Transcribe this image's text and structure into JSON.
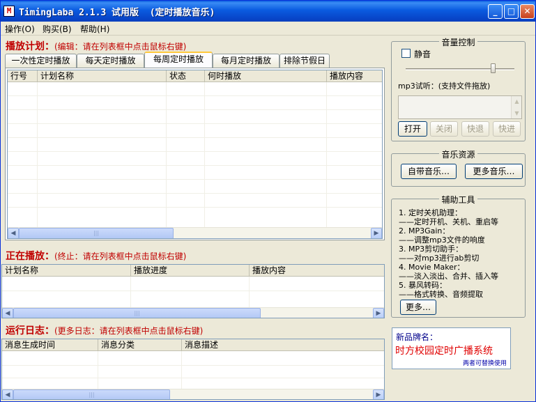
{
  "window": {
    "title": "TimingLaba 2.1.3 试用版  (定时播放音乐)",
    "icon_text": "M",
    "controls": {
      "minimize": "_",
      "maximize": "□",
      "close": "✕"
    }
  },
  "menu": [
    "操作(O)",
    "购买(B)",
    "帮助(H)"
  ],
  "schedule": {
    "title": "播放计划：",
    "hint": "(编辑：请在列表框中点击鼠标右键)",
    "tabs": [
      "一次性定时播放",
      "每天定时播放",
      "每周定时播放",
      "每月定时播放",
      "排除节假日"
    ],
    "active_tab": 2,
    "columns": [
      "行号",
      "计划名称",
      "状态",
      "何时播放",
      "播放内容"
    ]
  },
  "now_playing": {
    "title": "正在播放：",
    "hint": "(终止：请在列表框中点击鼠标右键)",
    "columns": [
      "计划名称",
      "播放进度",
      "播放内容"
    ]
  },
  "log": {
    "title": "运行日志：",
    "hint": "(更多日志：请在列表框中点击鼠标右键)",
    "columns": [
      "消息生成时间",
      "消息分类",
      "消息描述"
    ]
  },
  "volume": {
    "title": "音量控制",
    "mute_label": "静音",
    "mute_checked": false,
    "slider_level": 0.8,
    "mp3_label": "mp3试听：(支持文件拖放)",
    "buttons": [
      "打开",
      "关闭",
      "快退",
      "快进"
    ]
  },
  "music": {
    "title": "音乐资源",
    "builtin_button": "自带音乐…",
    "more_button": "更多音乐…"
  },
  "tools": {
    "title": "辅助工具",
    "lines": [
      "1. 定时关机助理：",
      "——定时开机、关机、重启等",
      "2. MP3Gain：",
      "——调整mp3文件的响度",
      "3. MP3剪切助手：",
      "——对mp3进行ab剪切",
      "4. Movie Maker：",
      "——淡入淡出、合并、插入等",
      "5. 暴风转码：",
      "——格式转换、音频提取"
    ],
    "more_button": "更多…"
  },
  "brand": {
    "label": "新品牌名：",
    "name": "时方校园定时广播系统",
    "note": "两者可替换使用"
  }
}
